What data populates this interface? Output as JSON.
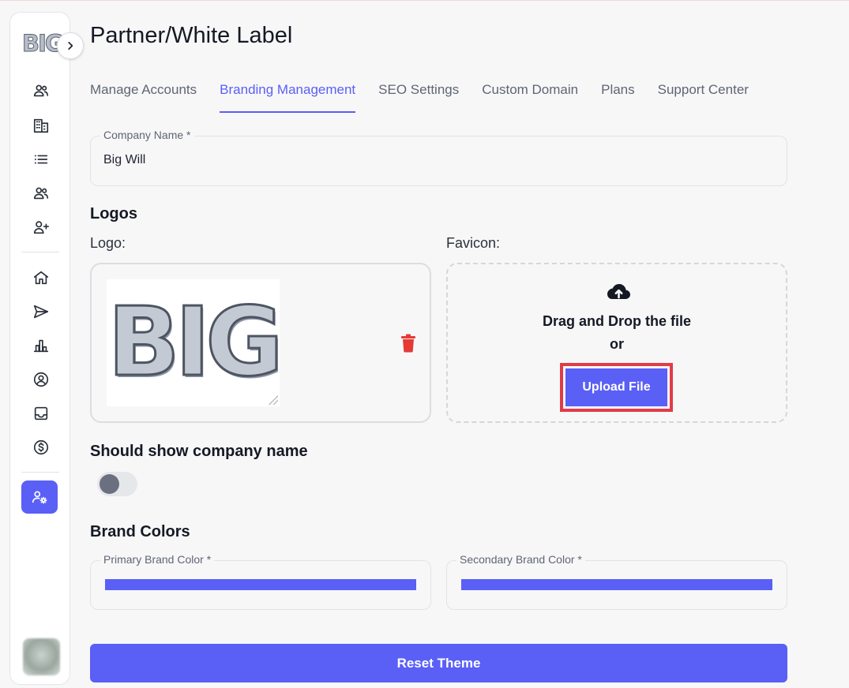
{
  "sidebar": {
    "logo_text": "BIG",
    "items": [
      {
        "icon": "users-icon"
      },
      {
        "icon": "building-icon"
      },
      {
        "icon": "list-icon"
      },
      {
        "icon": "team-icon"
      },
      {
        "icon": "add-user-icon"
      },
      {
        "icon": "home-icon"
      },
      {
        "icon": "send-icon"
      },
      {
        "icon": "bar-chart-icon"
      },
      {
        "icon": "user-circle-icon"
      },
      {
        "icon": "inbox-icon"
      },
      {
        "icon": "dollar-icon"
      },
      {
        "icon": "user-settings-icon",
        "active": true
      }
    ]
  },
  "page": {
    "title": "Partner/White Label"
  },
  "tabs": [
    {
      "label": "Manage Accounts"
    },
    {
      "label": "Branding Management",
      "active": true
    },
    {
      "label": "SEO Settings"
    },
    {
      "label": "Custom Domain"
    },
    {
      "label": "Plans"
    },
    {
      "label": "Support Center"
    }
  ],
  "form": {
    "company_name": {
      "label": "Company Name *",
      "value": "Big Will"
    },
    "logos_title": "Logos",
    "logo_label": "Logo:",
    "logo_image_text": "BIG",
    "favicon_label": "Favicon:",
    "drop_text_line1": "Drag and Drop the file",
    "drop_text_line2": "or",
    "upload_button": "Upload File",
    "show_company_name_title": "Should show company name",
    "show_company_name_enabled": false,
    "brand_colors_title": "Brand Colors",
    "primary_color": {
      "label": "Primary Brand Color *",
      "value": "#5a5ff6"
    },
    "secondary_color": {
      "label": "Secondary Brand Color *",
      "value": "#5a5ff6"
    },
    "reset_button": "Reset Theme"
  },
  "colors": {
    "accent": "#5a5ff6",
    "delete": "#e53935",
    "highlight": "#e23b47"
  }
}
